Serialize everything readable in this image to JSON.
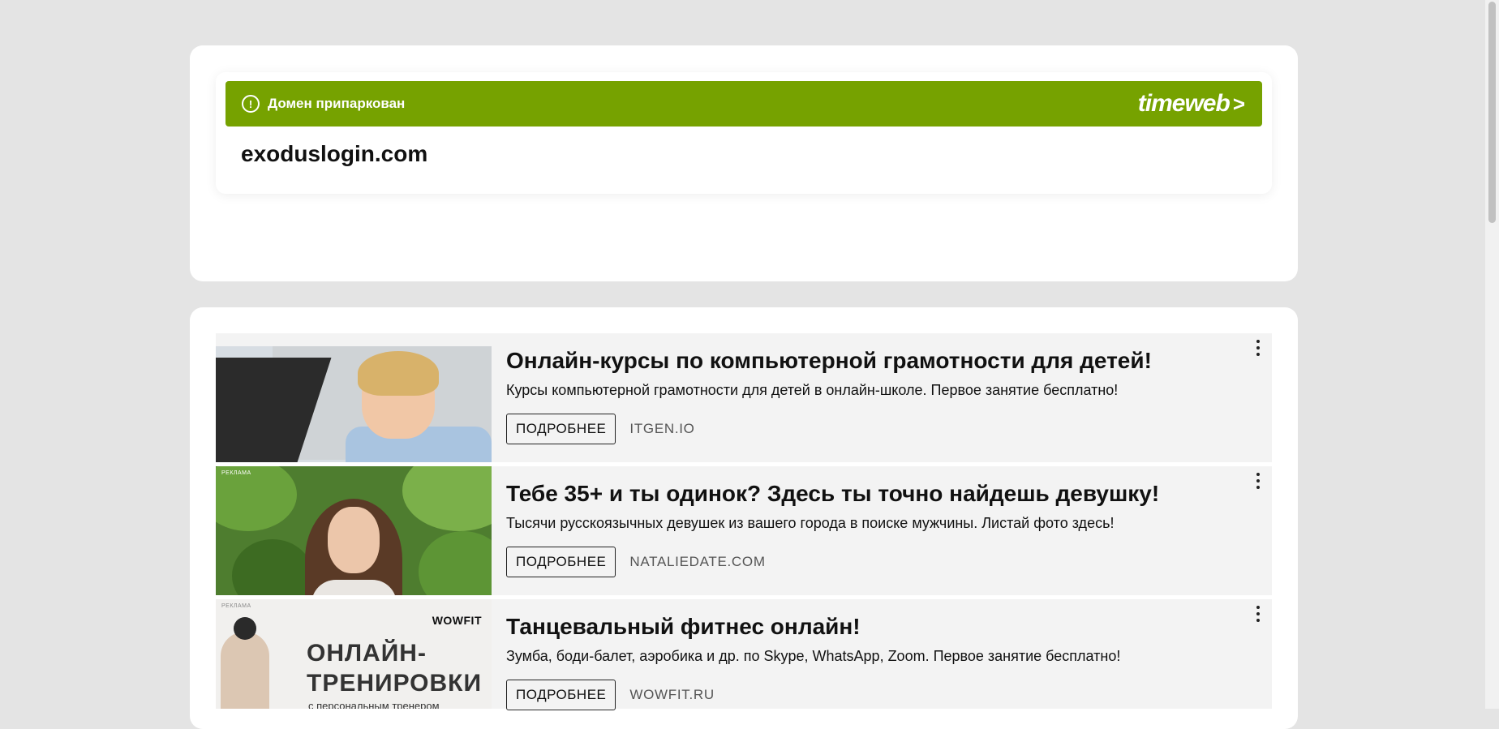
{
  "parking": {
    "status_text": "Домен припаркован",
    "brand": "timeweb",
    "brand_arrow": ">",
    "domain": "exoduslogin.com",
    "accent_color": "#76a200"
  },
  "ads": [
    {
      "title": "Онлайн-курсы по компьютерной грамотности для детей!",
      "description": "Курсы компьютерной грамотности для детей в онлайн-школе. Первое занятие бесплатно!",
      "button_label": "ПОДРОБНЕЕ",
      "site": "ITGEN.IO"
    },
    {
      "image_label": "РЕКЛАМА",
      "title": "Тебе 35+ и ты одинок? Здесь ты точно найдешь девушку!",
      "description": "Тысячи русскоязычных девушек из вашего города в поиске мужчины. Листай фото здесь!",
      "button_label": "ПОДРОБНЕЕ",
      "site": "NATALIEDATE.COM"
    },
    {
      "image_label": "РЕКЛАМА",
      "image_brand": "WOWFIT",
      "image_headline": "ОНЛАЙН-\nТРЕНИРОВКИ",
      "image_subline": "с персональным тренером",
      "title": "Танцевальный фитнес онлайн!",
      "description": "Зумба, боди-балет, аэробика и др. по Skype, WhatsApp, Zoom. Первое занятие бесплатно!",
      "button_label": "ПОДРОБНЕЕ",
      "site": "WOWFIT.RU"
    }
  ]
}
